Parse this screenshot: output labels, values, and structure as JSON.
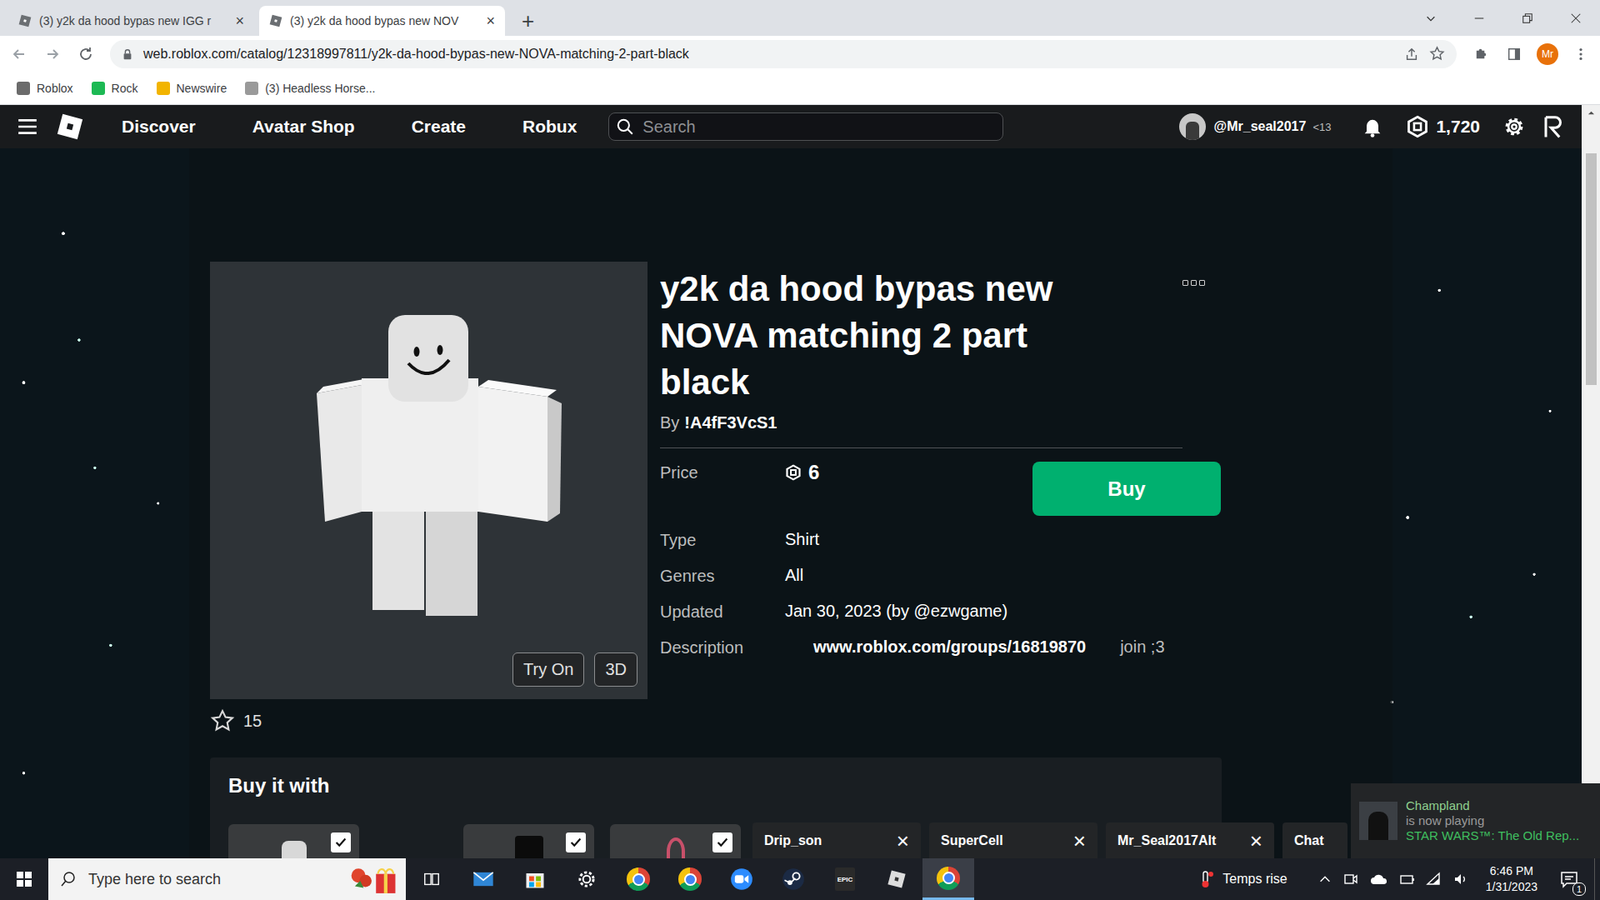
{
  "browser": {
    "tabs": [
      {
        "title": "(3) y2k da hood bypas new IGG r",
        "close": "×",
        "selected": false
      },
      {
        "title": "(3) y2k da hood bypas new NOV",
        "close": "×",
        "selected": true
      }
    ],
    "new_tab": "+",
    "url": "web.roblox.com/catalog/12318997811/y2k-da-hood-bypas-new-NOVA-matching-2-part-black",
    "profile": "Mr",
    "bookmarks": [
      {
        "label": "Roblox",
        "color": "#6b6b6b"
      },
      {
        "label": "Rock",
        "color": "#1db954"
      },
      {
        "label": "Newswire",
        "color": "#f2b400"
      },
      {
        "label": "(3) Headless Horse...",
        "color": "#9a9a9a"
      }
    ]
  },
  "nav": {
    "links": [
      "Discover",
      "Avatar Shop",
      "Create",
      "Robux"
    ],
    "search_placeholder": "Search",
    "username": "@Mr_seal2017",
    "age": "<13",
    "robux": "1,720"
  },
  "item": {
    "title": "y2k da hood bypas new NOVA matching 2 part black",
    "creator_prefix": "By",
    "creator": "!A4fF3VcS1",
    "price_label": "Price",
    "price": "6",
    "buy": "Buy",
    "try_on": "Try On",
    "view_3d": "3D",
    "favorites": "15",
    "details": [
      {
        "label": "Type",
        "value": "Shirt"
      },
      {
        "label": "Genres",
        "value": "All"
      },
      {
        "label": "Updated",
        "value": "Jan 30, 2023 (by @ezwgame)"
      },
      {
        "label": "Description",
        "value": "www.roblox.com/groups/16819870",
        "note": "join ;3"
      }
    ]
  },
  "bundle": {
    "title": "Buy it with",
    "items": [
      {
        "kind": "head",
        "checked": true
      },
      {
        "kind": "hat",
        "checked": true
      },
      {
        "kind": "ribbon",
        "checked": true
      }
    ]
  },
  "chat": {
    "tabs": [
      {
        "name": "Drip_son",
        "close": "×"
      },
      {
        "name": "SuperCell",
        "close": "×"
      },
      {
        "name": "Mr_Seal2017Alt",
        "close": "×"
      }
    ],
    "main": "Chat"
  },
  "toast": {
    "name": "Champland",
    "status": "is now playing",
    "game": "STAR WARS™: The Old Rep..."
  },
  "taskbar": {
    "search_placeholder": "Type here to search",
    "apps": [
      {
        "kind": "taskview",
        "active": false
      },
      {
        "kind": "mail",
        "active": false
      },
      {
        "kind": "store",
        "active": false
      },
      {
        "kind": "settings",
        "active": false
      },
      {
        "kind": "chrome",
        "active": false
      },
      {
        "kind": "chrome",
        "active": false
      },
      {
        "kind": "zoom",
        "active": false
      },
      {
        "kind": "steam",
        "active": false
      },
      {
        "kind": "epic",
        "label": "EPIC",
        "active": false
      },
      {
        "kind": "roblox",
        "active": false
      },
      {
        "kind": "chrome",
        "active": true
      }
    ],
    "weather": "Temps rise",
    "time": "6:46 PM",
    "date": "1/31/2023",
    "notifications": "1"
  }
}
